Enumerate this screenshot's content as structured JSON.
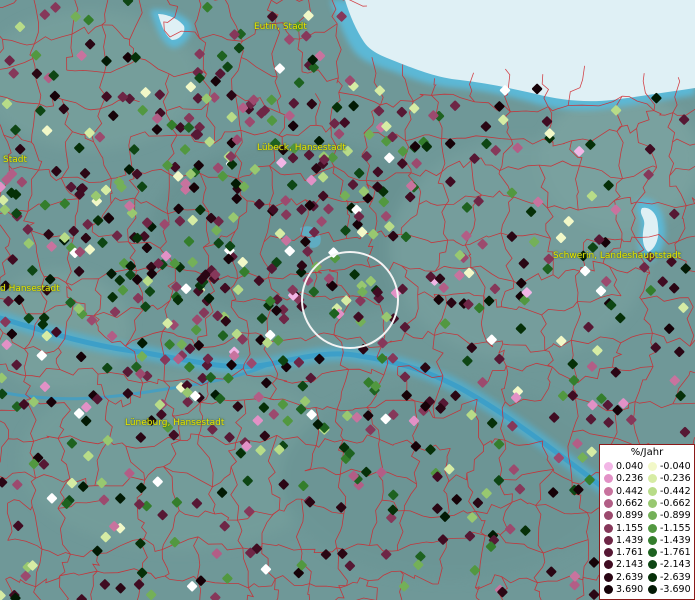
{
  "map": {
    "cities": [
      {
        "name": "Eutin, Stadt"
      },
      {
        "name": "Lübeck, Hansestadt"
      },
      {
        "name": "Stadt"
      },
      {
        "name": "Schwerin, Landeshauptstadt"
      },
      {
        "name": "d Hansestadt"
      },
      {
        "name": "Lüneburg, Hansestadt"
      }
    ]
  },
  "legend": {
    "title": "%/Jahr",
    "positive": [
      {
        "value": "0.040",
        "color": "#f2b6e6"
      },
      {
        "value": "0.236",
        "color": "#e291c6"
      },
      {
        "value": "0.442",
        "color": "#c8739e"
      },
      {
        "value": "0.662",
        "color": "#b25e86"
      },
      {
        "value": "0.899",
        "color": "#9c4a6e"
      },
      {
        "value": "1.155",
        "color": "#86385a"
      },
      {
        "value": "1.439",
        "color": "#6e2646"
      },
      {
        "value": "1.761",
        "color": "#561834"
      },
      {
        "value": "2.143",
        "color": "#400c22"
      },
      {
        "value": "2.639",
        "color": "#2a0614"
      },
      {
        "value": "3.690",
        "color": "#160208"
      }
    ],
    "negative": [
      {
        "value": "-0.040",
        "color": "#f2f8c8"
      },
      {
        "value": "-0.236",
        "color": "#d6eca4"
      },
      {
        "value": "-0.442",
        "color": "#b8dc88"
      },
      {
        "value": "-0.662",
        "color": "#98c870"
      },
      {
        "value": "-0.899",
        "color": "#74b058"
      },
      {
        "value": "-1.155",
        "color": "#529840"
      },
      {
        "value": "-1.439",
        "color": "#347e2c"
      },
      {
        "value": "-1.761",
        "color": "#1e6220"
      },
      {
        "value": "-2.143",
        "color": "#0e4614"
      },
      {
        "value": "-2.639",
        "color": "#063008"
      },
      {
        "value": "-3.690",
        "color": "#021a04"
      }
    ]
  }
}
